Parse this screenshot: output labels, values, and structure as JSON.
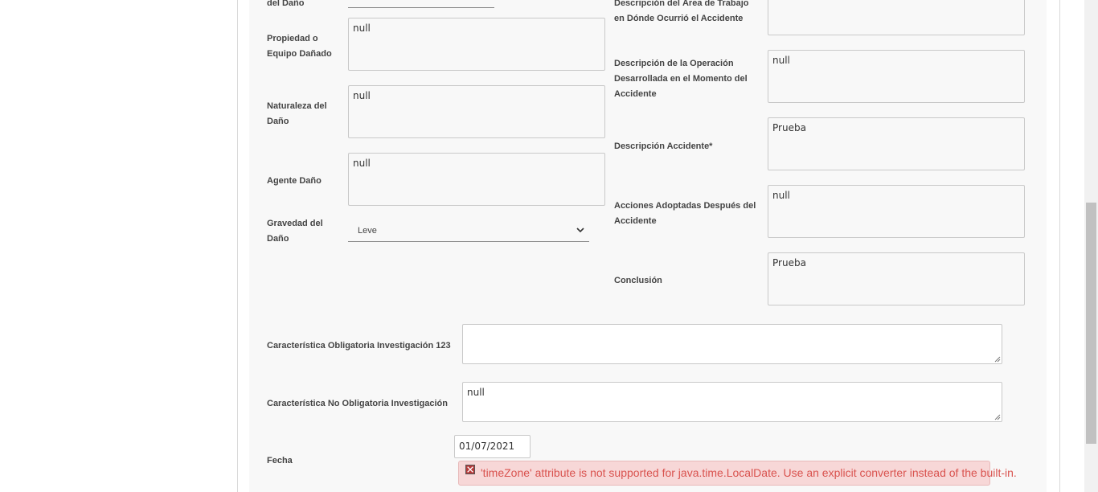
{
  "left_column": {
    "label_danio_partial": "del Daño",
    "propiedad_label": "Propiedad o\nEquipo Dañado",
    "propiedad_value": "null",
    "naturaleza_label": "Naturaleza del\nDaño",
    "naturaleza_value": "null",
    "agente_label": "Agente Daño",
    "agente_value": "null",
    "gravedad_label": "Gravedad del\nDaño",
    "gravedad_value": "Leve"
  },
  "right_column": {
    "area_label": "Descripción del Área de Trabajo\nen Dónde Ocurrió el Accidente",
    "operacion_label": "Descripción de la Operación\nDesarrollada en el Momento del\nAccidente",
    "operacion_value": "null",
    "accidente_label": "Descripción Accidente*",
    "accidente_value": "Prueba",
    "acciones_label": "Acciones Adoptadas Después del\nAccidente",
    "acciones_value": "null",
    "conclusion_label": "Conclusión",
    "conclusion_value": "Prueba"
  },
  "bottom": {
    "oblig_label": "Característica Obligatoria Investigación 123",
    "oblig_value": "",
    "no_oblig_label": "Característica No Obligatoria Investigación",
    "no_oblig_value": "null",
    "fecha_label": "Fecha",
    "fecha_value": "01/07/2021",
    "error_message": "'timeZone' attribute is not supported for java.time.LocalDate. Use an explicit converter instead of the built-in."
  },
  "icons": {
    "error": "error-x-icon",
    "select_chevron": "chevron-down-icon"
  }
}
